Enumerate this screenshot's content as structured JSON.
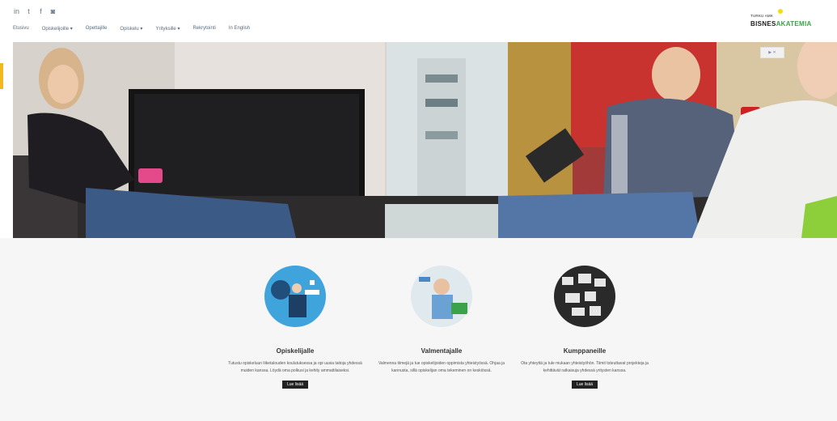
{
  "header": {
    "social_icons": [
      "linkedin-icon",
      "twitter-icon",
      "facebook-icon",
      "instagram-icon"
    ],
    "social_glyphs": [
      "in",
      "t",
      "f",
      "◙"
    ],
    "nav_items": [
      "Etusivu",
      "Opiskelijoille ▾",
      "Opettajille",
      "Opiskelu ▾",
      "Yrityksille ▾",
      "Rekrytointi",
      "In English"
    ]
  },
  "logo": {
    "small_text": "TURKU AMK",
    "brand_part1": "BISNES",
    "brand_part2": "AKATEMIA"
  },
  "hero_ad": "▶ ✕",
  "cards": [
    {
      "title": "Opiskelijalle",
      "text": "Tutustu opiskeluun liiketalouden koulutuksessa ja opi uusia taitoja yhdessä muiden kanssa. Löydä oma polkusi ja kehity ammattilaiseksi.",
      "button": "Lue lisää"
    },
    {
      "title": "Valmentajalle",
      "text": "Valmenna tiimejä ja tue opiskelijoiden oppimista yhteistyössä. Ohjaa ja kannusta, sillä opiskelijan oma tekeminen on keskiössä.",
      "button": "Lue lisää"
    },
    {
      "title": "Kumppaneille",
      "text": "Ota yhteyttä ja tule mukaan yhteistyöhön. Tiimit toteuttavat projekteja ja kehittävät ratkaisuja yhdessä yritysten kanssa.",
      "button": "Lue lisää"
    }
  ],
  "colors": {
    "accent_yellow": "#f2b820",
    "logo_green": "#3aa24a",
    "nav_text": "#5a6b7d",
    "cards_bg": "#f6f6f6"
  }
}
